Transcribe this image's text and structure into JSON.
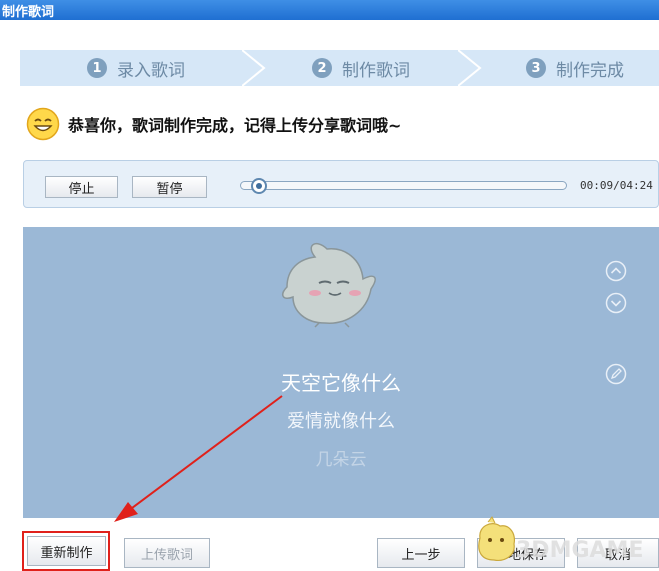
{
  "window": {
    "title": "制作歌词"
  },
  "steps": [
    {
      "num": "1",
      "label": "录入歌词"
    },
    {
      "num": "2",
      "label": "制作歌词"
    },
    {
      "num": "3",
      "label": "制作完成"
    }
  ],
  "congrats": {
    "icon": "smiley-icon",
    "message": "恭喜你，歌词制作完成，记得上传分享歌词哦~"
  },
  "player": {
    "stop_label": "停止",
    "pause_label": "暂停",
    "time": "00:09/04:24",
    "progress": 0.034
  },
  "lyrics": {
    "line1": "天空它像什么",
    "line2": "爱情就像什么",
    "line3": "几朵云"
  },
  "bottom": {
    "redo_label": "重新制作",
    "upload_label": "上传歌词",
    "prev_label": "上一步",
    "save_label": "本地保存",
    "cancel_label": "取消"
  },
  "watermark": {
    "text": "3DMGAME"
  },
  "colors": {
    "titlebar": "#2b7fe0",
    "steps_bg": "#d6e7f7",
    "lyric_bg": "#9bb8d6",
    "highlight": "#e0211b"
  }
}
